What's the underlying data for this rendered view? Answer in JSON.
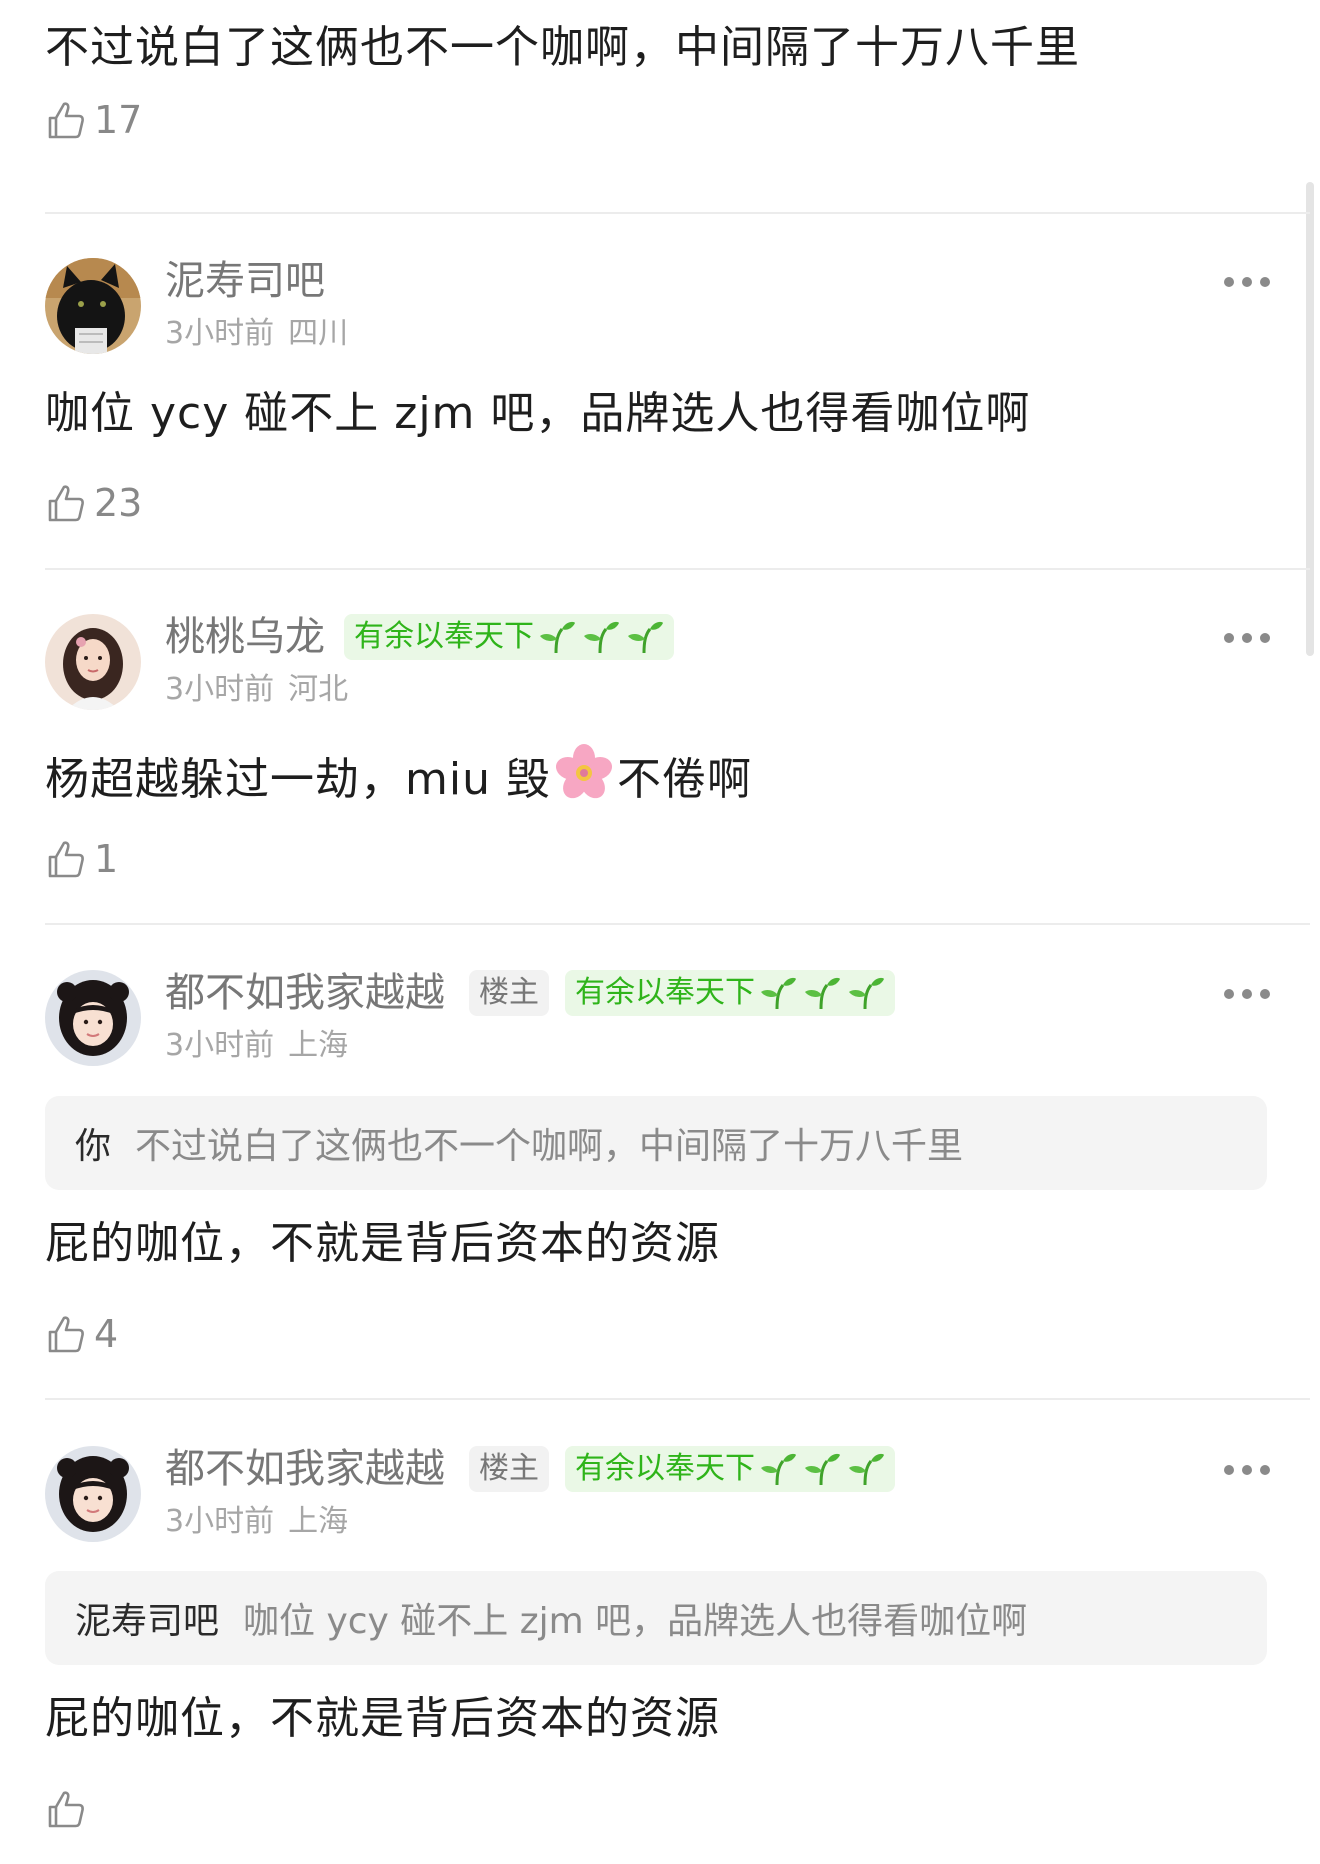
{
  "colors": {
    "level_badge_text": "#2fb41a",
    "level_badge_bg": "#eaf8e6",
    "op_badge_bg": "#f2f2f2",
    "quote_bg": "#f4f4f4",
    "muted_text": "#888888"
  },
  "top_comment": {
    "text": "不过说白了这俩也不一个咖啊，中间隔了十万八千里",
    "like_icon": "thumb-up-icon",
    "likes": "17"
  },
  "comments": [
    {
      "username": "泥寿司吧",
      "avatar_icon": "black-cat-avatar",
      "time": "3小时前",
      "location": "四川",
      "text": "咖位 ycy 碰不上 zjm 吧，品牌选人也得看咖位啊",
      "likes": "23",
      "more_icon": "more-dots-icon"
    },
    {
      "username": "桃桃乌龙",
      "avatar_icon": "girl-portrait-avatar",
      "level_badge": "有余以奉天下",
      "level_icon": "sprout-icon",
      "time": "3小时前",
      "location": "河北",
      "text_before": "杨超越躲过一劫，miu 毁",
      "emoji": "cherry-blossom-emoji",
      "text_after": "不倦啊",
      "likes": "1",
      "more_icon": "more-dots-icon"
    },
    {
      "username": "都不如我家越越",
      "avatar_icon": "girl-portrait-avatar",
      "op_badge": "楼主",
      "level_badge": "有余以奉天下",
      "time": "3小时前",
      "location": "上海",
      "quote_author": "你",
      "quote_text": "不过说白了这俩也不一个咖啊，中间隔了十万八千里",
      "text": "屁的咖位，不就是背后资本的资源",
      "likes": "4",
      "more_icon": "more-dots-icon"
    },
    {
      "username": "都不如我家越越",
      "avatar_icon": "girl-portrait-avatar",
      "op_badge": "楼主",
      "level_badge": "有余以奉天下",
      "time": "3小时前",
      "location": "上海",
      "quote_author": "泥寿司吧",
      "quote_text": "咖位 ycy 碰不上 zjm 吧，品牌选人也得看咖位啊",
      "text": "屁的咖位，不就是背后资本的资源",
      "likes": "",
      "more_icon": "more-dots-icon"
    }
  ]
}
